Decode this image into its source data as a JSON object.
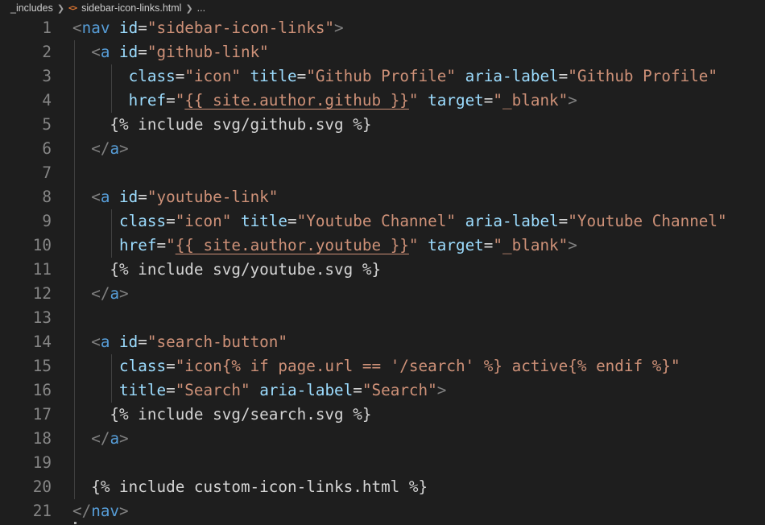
{
  "breadcrumb": {
    "folder": "_includes",
    "file_icon": "<>",
    "file": "sidebar-icon-links.html",
    "more": "..."
  },
  "colors": {
    "background": "#1e1e1e",
    "line_number": "#858585",
    "tag_bracket": "#808080",
    "tag_name": "#569cd6",
    "attribute": "#9cdcfe",
    "string": "#ce9178",
    "text": "#d4d4d4",
    "file_icon": "#e37933"
  },
  "lines": [
    {
      "n": "1",
      "tokens": [
        [
          "punc",
          "<"
        ],
        [
          "tag",
          "nav"
        ],
        [
          "text",
          " "
        ],
        [
          "attr",
          "id"
        ],
        [
          "eq",
          "="
        ],
        [
          "str",
          "\"sidebar-icon-links\""
        ],
        [
          "punc",
          ">"
        ]
      ]
    },
    {
      "n": "2",
      "tokens": [
        [
          "text",
          "  "
        ],
        [
          "punc",
          "<"
        ],
        [
          "tag",
          "a"
        ],
        [
          "text",
          " "
        ],
        [
          "attr",
          "id"
        ],
        [
          "eq",
          "="
        ],
        [
          "str",
          "\"github-link\""
        ]
      ]
    },
    {
      "n": "3",
      "tokens": [
        [
          "text",
          "      "
        ],
        [
          "attr",
          "class"
        ],
        [
          "eq",
          "="
        ],
        [
          "str",
          "\"icon\""
        ],
        [
          "text",
          " "
        ],
        [
          "attr",
          "title"
        ],
        [
          "eq",
          "="
        ],
        [
          "str",
          "\"Github Profile\""
        ],
        [
          "text",
          " "
        ],
        [
          "attr",
          "aria-label"
        ],
        [
          "eq",
          "="
        ],
        [
          "str",
          "\"Github Profile\""
        ]
      ]
    },
    {
      "n": "4",
      "tokens": [
        [
          "text",
          "      "
        ],
        [
          "attr",
          "href"
        ],
        [
          "eq",
          "="
        ],
        [
          "str",
          "\""
        ],
        [
          "u",
          "{{ site.author.github }}"
        ],
        [
          "str",
          "\""
        ],
        [
          "text",
          " "
        ],
        [
          "attr",
          "target"
        ],
        [
          "eq",
          "="
        ],
        [
          "str",
          "\"_blank\""
        ],
        [
          "punc",
          ">"
        ]
      ]
    },
    {
      "n": "5",
      "tokens": [
        [
          "text",
          "    {% include svg/github.svg %}"
        ]
      ]
    },
    {
      "n": "6",
      "tokens": [
        [
          "text",
          "  "
        ],
        [
          "punc",
          "</"
        ],
        [
          "tag",
          "a"
        ],
        [
          "punc",
          ">"
        ]
      ]
    },
    {
      "n": "7",
      "tokens": []
    },
    {
      "n": "8",
      "tokens": [
        [
          "text",
          "  "
        ],
        [
          "punc",
          "<"
        ],
        [
          "tag",
          "a"
        ],
        [
          "text",
          " "
        ],
        [
          "attr",
          "id"
        ],
        [
          "eq",
          "="
        ],
        [
          "str",
          "\"youtube-link\""
        ]
      ]
    },
    {
      "n": "9",
      "tokens": [
        [
          "text",
          "     "
        ],
        [
          "attr",
          "class"
        ],
        [
          "eq",
          "="
        ],
        [
          "str",
          "\"icon\""
        ],
        [
          "text",
          " "
        ],
        [
          "attr",
          "title"
        ],
        [
          "eq",
          "="
        ],
        [
          "str",
          "\"Youtube Channel\""
        ],
        [
          "text",
          " "
        ],
        [
          "attr",
          "aria-label"
        ],
        [
          "eq",
          "="
        ],
        [
          "str",
          "\"Youtube Channel\""
        ]
      ]
    },
    {
      "n": "10",
      "tokens": [
        [
          "text",
          "     "
        ],
        [
          "attr",
          "href"
        ],
        [
          "eq",
          "="
        ],
        [
          "str",
          "\""
        ],
        [
          "u",
          "{{ site.author.youtube }}"
        ],
        [
          "str",
          "\""
        ],
        [
          "text",
          " "
        ],
        [
          "attr",
          "target"
        ],
        [
          "eq",
          "="
        ],
        [
          "str",
          "\"_blank\""
        ],
        [
          "punc",
          ">"
        ]
      ]
    },
    {
      "n": "11",
      "tokens": [
        [
          "text",
          "    {% include svg/youtube.svg %}"
        ]
      ]
    },
    {
      "n": "12",
      "tokens": [
        [
          "text",
          "  "
        ],
        [
          "punc",
          "</"
        ],
        [
          "tag",
          "a"
        ],
        [
          "punc",
          ">"
        ]
      ]
    },
    {
      "n": "13",
      "tokens": []
    },
    {
      "n": "14",
      "tokens": [
        [
          "text",
          "  "
        ],
        [
          "punc",
          "<"
        ],
        [
          "tag",
          "a"
        ],
        [
          "text",
          " "
        ],
        [
          "attr",
          "id"
        ],
        [
          "eq",
          "="
        ],
        [
          "str",
          "\"search-button\""
        ]
      ]
    },
    {
      "n": "15",
      "tokens": [
        [
          "text",
          "     "
        ],
        [
          "attr",
          "class"
        ],
        [
          "eq",
          "="
        ],
        [
          "str",
          "\"icon{% if page.url == '/search' %} active{% endif %}\""
        ]
      ]
    },
    {
      "n": "16",
      "tokens": [
        [
          "text",
          "     "
        ],
        [
          "attr",
          "title"
        ],
        [
          "eq",
          "="
        ],
        [
          "str",
          "\"Search\""
        ],
        [
          "text",
          " "
        ],
        [
          "attr",
          "aria-label"
        ],
        [
          "eq",
          "="
        ],
        [
          "str",
          "\"Search\""
        ],
        [
          "punc",
          ">"
        ]
      ]
    },
    {
      "n": "17",
      "tokens": [
        [
          "text",
          "    {% include svg/search.svg %}"
        ]
      ]
    },
    {
      "n": "18",
      "tokens": [
        [
          "text",
          "  "
        ],
        [
          "punc",
          "</"
        ],
        [
          "tag",
          "a"
        ],
        [
          "punc",
          ">"
        ]
      ]
    },
    {
      "n": "19",
      "tokens": []
    },
    {
      "n": "20",
      "tokens": [
        [
          "text",
          "  {% include custom-icon-links.html %}"
        ]
      ]
    },
    {
      "n": "21",
      "tokens": [
        [
          "punc",
          "</"
        ],
        [
          "tag",
          "nav"
        ],
        [
          "punc",
          ">"
        ]
      ]
    }
  ]
}
